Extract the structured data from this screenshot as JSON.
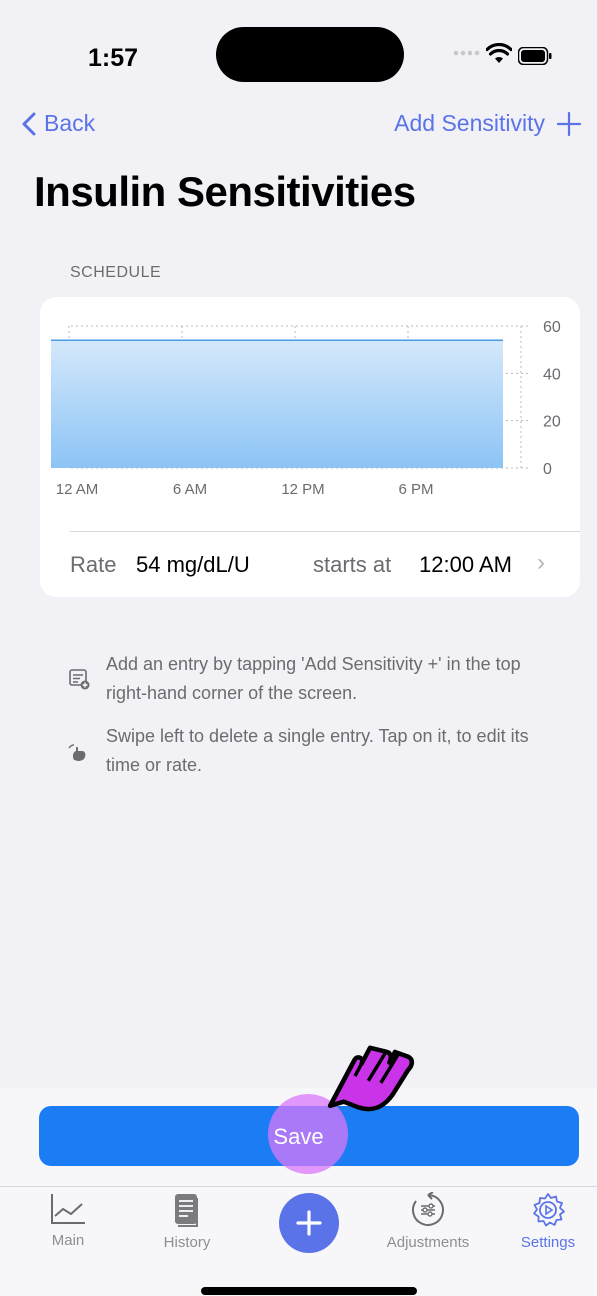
{
  "status_bar": {
    "time": "1:57"
  },
  "nav": {
    "back_label": "Back",
    "add_label": "Add Sensitivity"
  },
  "page": {
    "title": "Insulin Sensitivities"
  },
  "schedule": {
    "section_header": "SCHEDULE",
    "rate_label": "Rate",
    "rate_value": "54 mg/dL/U",
    "starts_label": "starts at",
    "starts_value": "12:00 AM"
  },
  "chart_data": {
    "type": "area",
    "x_tick_labels": [
      "12 AM",
      "6 AM",
      "12 PM",
      "6 PM"
    ],
    "y_ticks": [
      0,
      20,
      40,
      60
    ],
    "ylim": [
      0,
      60
    ],
    "series": [
      {
        "x": [
          "12 AM",
          "12 AM (next day)"
        ],
        "values": [
          54,
          54
        ]
      }
    ],
    "grid": true,
    "fill_color": "#8cc4f5",
    "line_color": "#4a9ae8"
  },
  "info": {
    "line1": "Add an entry by tapping 'Add Sensitivity +' in the top right-hand corner of the screen.",
    "line2": "Swipe left to delete a single entry. Tap on it, to edit its time or rate."
  },
  "save_button": {
    "label": "Save"
  },
  "tabs": [
    {
      "label": "Main",
      "icon": "chart-line-icon"
    },
    {
      "label": "History",
      "icon": "document-icon"
    },
    {
      "label": "Adjustments",
      "icon": "adjustments-icon"
    },
    {
      "label": "Settings",
      "icon": "gear-icon",
      "active": true
    }
  ],
  "colors": {
    "accent": "#5b73e8",
    "save_button": "#1b7cf4",
    "background": "#f2f2f6"
  }
}
